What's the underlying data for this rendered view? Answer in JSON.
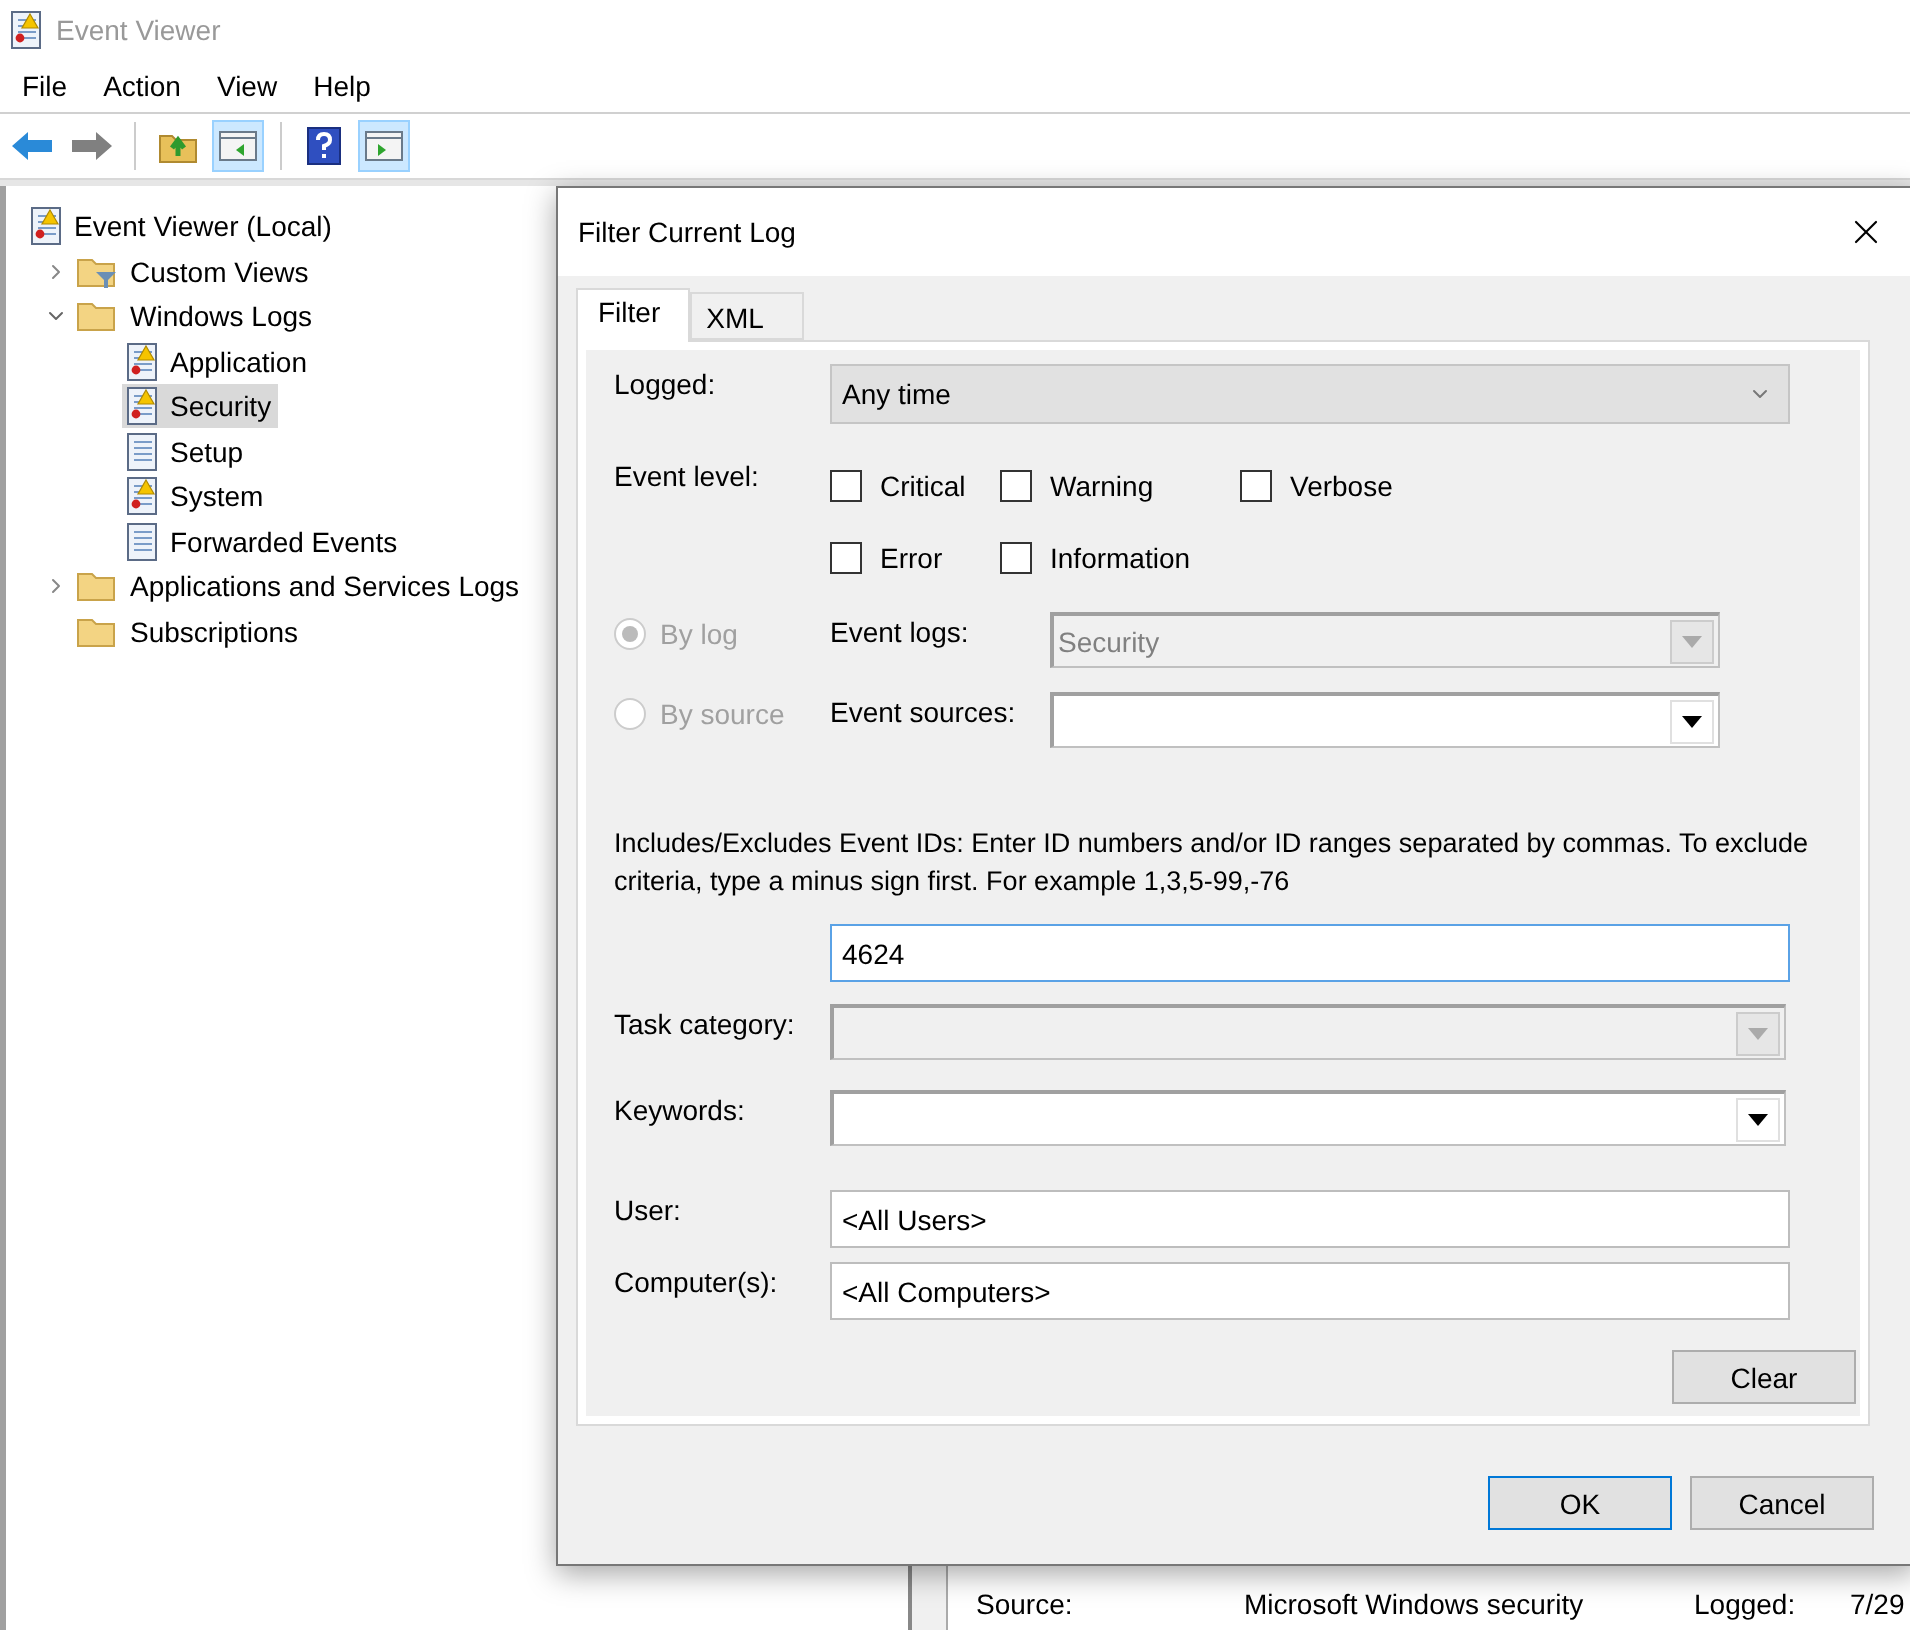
{
  "window": {
    "title": "Event Viewer"
  },
  "menu": [
    "File",
    "Action",
    "View",
    "Help"
  ],
  "tree": [
    {
      "label": "Event Viewer (Local)",
      "selected": false,
      "kind": "log",
      "children": [
        {
          "label": "Custom Views",
          "expanded": false,
          "selected": false,
          "kind": "filter-folder"
        },
        {
          "label": "Windows Logs",
          "expanded": true,
          "selected": false,
          "kind": "folder",
          "children": [
            {
              "label": "Application",
              "selected": false,
              "kind": "log"
            },
            {
              "label": "Security",
              "selected": true,
              "kind": "log"
            },
            {
              "label": "Setup",
              "selected": false,
              "kind": "plain-log"
            },
            {
              "label": "System",
              "selected": false,
              "kind": "log"
            },
            {
              "label": "Forwarded Events",
              "selected": false,
              "kind": "plain-log"
            }
          ]
        },
        {
          "label": "Applications and Services Logs",
          "expanded": false,
          "selected": false,
          "kind": "folder"
        },
        {
          "label": "Subscriptions",
          "selected": false,
          "kind": "folder"
        }
      ]
    }
  ],
  "details": [
    {
      "label": "Source:",
      "value": "Microsoft Windows security"
    },
    {
      "label": "Logged:",
      "value": "7/29"
    }
  ],
  "dialog": {
    "title": "Filter Current Log",
    "tabs": [
      {
        "label": "Filter",
        "selected": true
      },
      {
        "label": "XML",
        "selected": false
      }
    ],
    "logged": {
      "label": "Logged:",
      "value": "Any time"
    },
    "event_level": {
      "label": "Event level:",
      "options": [
        {
          "label": "Critical",
          "checked": false
        },
        {
          "label": "Warning",
          "checked": false
        },
        {
          "label": "Verbose",
          "checked": false
        },
        {
          "label": "Error",
          "checked": false
        },
        {
          "label": "Information",
          "checked": false
        }
      ]
    },
    "scope": [
      {
        "label": "By log",
        "selected": true,
        "disabled": true,
        "field_label": "Event logs:",
        "field_value": "Security",
        "field_disabled": true
      },
      {
        "label": "By source",
        "selected": false,
        "disabled": true,
        "field_label": "Event sources:",
        "field_disabled": false
      }
    ],
    "ids_help": "Includes/Excludes Event IDs: Enter ID numbers and/or ID ranges separated by commas. To exclude criteria, type a minus sign first. For example 1,3,5-99,-76",
    "ids_value": "4624",
    "task_category": {
      "label": "Task category:",
      "disabled": true
    },
    "keywords": {
      "label": "Keywords:",
      "disabled": false
    },
    "user": {
      "label": "User:",
      "value": "<All Users>"
    },
    "computers": {
      "label": "Computer(s):",
      "value": "<All Computers>"
    },
    "clear": "Clear",
    "ok": "OK",
    "cancel": "Cancel"
  }
}
